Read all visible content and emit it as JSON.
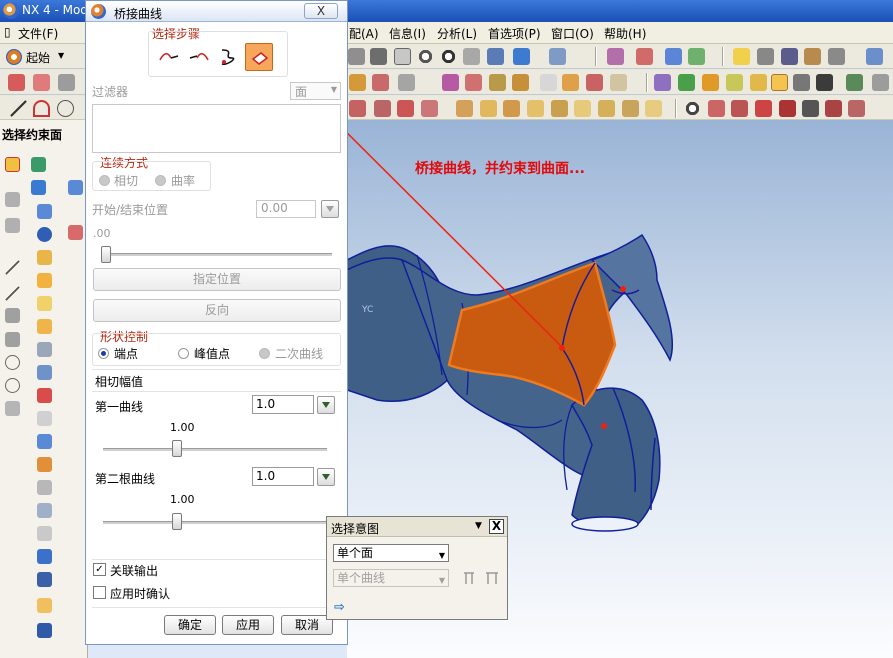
{
  "app": {
    "title": "NX 4 - Mod"
  },
  "menubar": {
    "items": [
      "文件(F)",
      "配(A)",
      "信息(I)",
      "分析(L)",
      "首选项(P)",
      "窗口(O)",
      "帮助(H)"
    ]
  },
  "toolbar": {
    "start_label": "起始"
  },
  "left_panel": {
    "title": "选择约束面"
  },
  "dialog": {
    "title": "桥接曲线",
    "close_label": "X",
    "steps_label": "选择步骤",
    "filter_label": "过滤器",
    "filter_value": "面",
    "continuity_label": "连续方式",
    "continuity_options": [
      "相切",
      "曲率"
    ],
    "start_end_label": "开始/结束位置",
    "start_end_value": "0.00",
    "position_slider_value": ".00",
    "specify_position_label": "指定位置",
    "reverse_label": "反向",
    "shape_control_label": "形状控制",
    "shape_options": [
      "端点",
      "峰值点",
      "二次曲线"
    ],
    "tangent_magnitude_label": "相切幅值",
    "first_curve_label": "第一曲线",
    "first_curve_value": "1.0",
    "first_curve_slider_value": "1.00",
    "first_curve_slider_fraction": 0.33,
    "second_curve_label": "第二根曲线",
    "second_curve_value": "1.0",
    "second_curve_slider_value": "1.00",
    "second_curve_slider_fraction": 0.33,
    "assoc_output_label": "关联输出",
    "assoc_output_checked": true,
    "confirm_on_apply_label": "应用时确认",
    "confirm_on_apply_checked": false,
    "ok_label": "确定",
    "apply_label": "应用",
    "cancel_label": "取消"
  },
  "intent_popup": {
    "title": "选择意图",
    "close_label": "X",
    "face_rule": "单个面",
    "curve_rule": "单个曲线"
  },
  "annotation": {
    "text": "桥接曲线，并约束到曲面...",
    "color": "#e4090a"
  },
  "viewport": {
    "axis_label": "YC",
    "surface_color": "#3f5f86",
    "bridge_color": "#c85b10"
  }
}
